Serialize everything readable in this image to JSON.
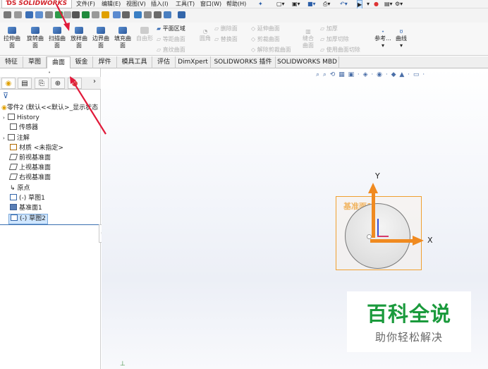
{
  "app": {
    "logo": "SOLIDWORKS"
  },
  "menu": [
    "文件(F)",
    "编辑(E)",
    "视图(V)",
    "插入(I)",
    "工具(T)",
    "窗口(W)",
    "帮助(H)"
  ],
  "ribbon": {
    "big_buttons": [
      {
        "line1": "拉伸曲",
        "line2": "面"
      },
      {
        "line1": "旋转曲",
        "line2": "面"
      },
      {
        "line1": "扫描曲",
        "line2": "面"
      },
      {
        "line1": "放样曲",
        "line2": "面"
      },
      {
        "line1": "边界曲",
        "line2": "面"
      },
      {
        "line1": "填充曲",
        "line2": "面"
      },
      {
        "line1": "自由形",
        "line2": ""
      }
    ],
    "col_plane": [
      "平面区域",
      "等距曲面",
      "直纹曲面"
    ],
    "corner": "圆角",
    "col_delete": [
      "删除面",
      "替换面"
    ],
    "col_extend": [
      "延伸曲面",
      "剪裁曲面",
      "解除剪裁曲面"
    ],
    "knit": {
      "line1": "缝合",
      "line2": "曲面"
    },
    "col_thicken": [
      "加厚",
      "加厚切除",
      "使用曲面切除"
    ],
    "reference": "参考...",
    "curves": "曲线"
  },
  "tabs": [
    "特征",
    "草图",
    "曲面",
    "钣金",
    "焊件",
    "模具工具",
    "评估",
    "DimXpert",
    "SOLIDWORKS 插件",
    "SOLIDWORKS MBD"
  ],
  "active_tab": "曲面",
  "tree": {
    "root": "零件2  (默认<<默认>_显示状态",
    "items": [
      "History",
      "传感器",
      "注解",
      "材质 <未指定>",
      "前视基准面",
      "上视基准面",
      "右视基准面",
      "原点",
      "(-) 草图1",
      "基准面1",
      "(-) 草图2"
    ]
  },
  "viewport": {
    "plane_label": "基准面1",
    "axis_x": "X",
    "axis_y": "Y"
  },
  "watermark": {
    "title": "百科全说",
    "subtitle": "助你轻松解决"
  },
  "colors": {
    "accent_orange": "#f0a030",
    "watermark_green": "#1a9a3c",
    "selection_blue": "#cfe6ff",
    "arrow_red": "#e11a3a"
  }
}
